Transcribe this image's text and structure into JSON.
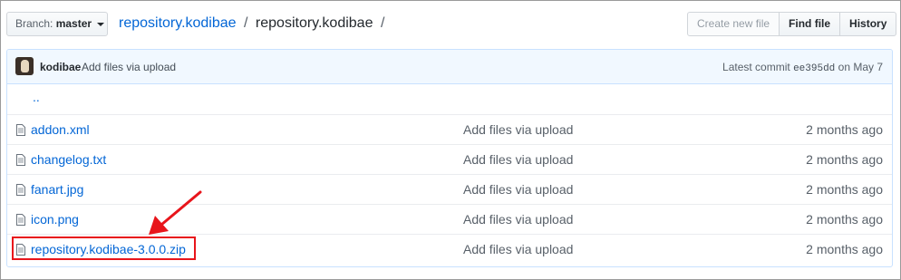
{
  "branch": {
    "label": "Branch:",
    "value": "master"
  },
  "breadcrumb": {
    "repo": "repository.kodibae",
    "sep1": "/",
    "folder": "repository.kodibae",
    "sep2": "/"
  },
  "actions": {
    "create": "Create new file",
    "find": "Find file",
    "history": "History"
  },
  "commit": {
    "author": "kodibae",
    "message": "Add files via upload",
    "latest_label": "Latest commit",
    "sha": "ee395dd",
    "date": "on May 7"
  },
  "parent_dir": "..",
  "files": [
    {
      "name": "addon.xml",
      "message": "Add files via upload",
      "age": "2 months ago"
    },
    {
      "name": "changelog.txt",
      "message": "Add files via upload",
      "age": "2 months ago"
    },
    {
      "name": "fanart.jpg",
      "message": "Add files via upload",
      "age": "2 months ago"
    },
    {
      "name": "icon.png",
      "message": "Add files via upload",
      "age": "2 months ago"
    },
    {
      "name": "repository.kodibae-3.0.0.zip",
      "message": "Add files via upload",
      "age": "2 months ago"
    }
  ],
  "colors": {
    "link": "#0366d6",
    "annotation": "#e8151b",
    "commit_bg": "#f1f8ff"
  }
}
